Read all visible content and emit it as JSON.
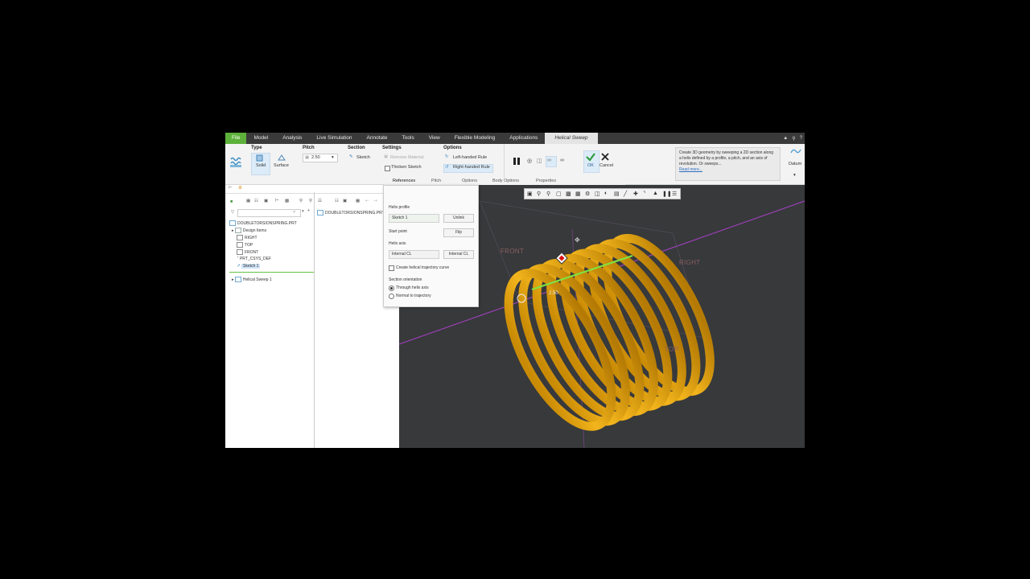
{
  "tabs": [
    "File",
    "Model",
    "Analysis",
    "Live Simulation",
    "Annotate",
    "Tools",
    "View",
    "Flexible Modeling",
    "Applications",
    "Helical Sweep"
  ],
  "ribbon": {
    "type": {
      "title": "Type",
      "solid": "Solid",
      "surface": "Surface"
    },
    "pitch": {
      "title": "Pitch",
      "value": "2.50"
    },
    "section": {
      "title": "Section",
      "sketch": "Sketch"
    },
    "settings": {
      "title": "Settings",
      "remove_material": "Remove Material",
      "thicken_sketch": "Thicken Sketch"
    },
    "options": {
      "title": "Options",
      "left_handed": "Left-handed Rule",
      "right_handed": "Right-handed Rule"
    },
    "ok": "OK",
    "cancel": "Cancel",
    "datum": "Datum",
    "help": {
      "text": "Create 3D geometry by sweeping a 2D section along a helix defined by a profile, a pitch, and an axis of revolution. Or sweeps...",
      "link": "Read more..."
    }
  },
  "subtabs": [
    "References",
    "Pitch",
    "Options",
    "Body Options",
    "Properties"
  ],
  "tree": {
    "root": "DOUBLETORSIONSPRING.PRT",
    "items": [
      "Design Items",
      "RIGHT",
      "TOP",
      "FRONT",
      "PRT_CSYS_DEF",
      "Sketch 1"
    ],
    "feature": "Helical Sweep 1",
    "second_root": "DOUBLETORSIONSPRING.PRT"
  },
  "panel": {
    "helix_profile_label": "Helix profile",
    "helix_profile_value": "Sketch 1",
    "unlink": "Unlink",
    "start_point": "Start point",
    "flip": "Flip",
    "helix_axis_label": "Helix axis",
    "helix_axis_value": "Internal CL",
    "internal_cl": "Internal CL",
    "create_trajectory": "Create helical trajectory curve",
    "section_orientation": "Section orientation",
    "through_axis": "Through helix axis",
    "normal_trajectory": "Normal to trajectory"
  },
  "viewport": {
    "front": "FRONT",
    "right": "RIGHT",
    "top": "TOP",
    "dim": "2.50"
  },
  "colors": {
    "spring": "#e8a50f",
    "file_tab": "#5db13a",
    "viewport_bg": "#37393b",
    "datum_plane": "#9a3fb3"
  }
}
